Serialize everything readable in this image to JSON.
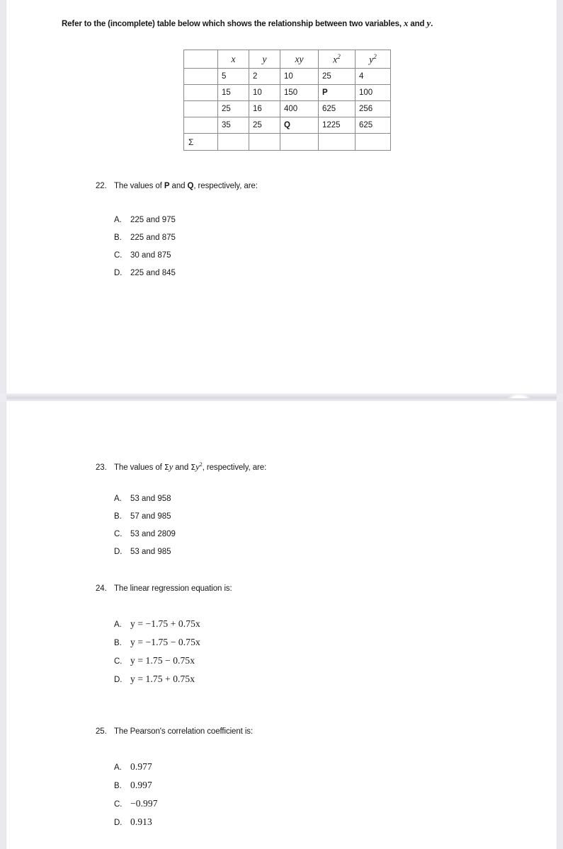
{
  "document": {
    "intro": {
      "before": "Refer to the (incomplete) table below which shows the relationship between two variables, ",
      "var_x": "x",
      "mid": " and ",
      "var_y": "y",
      "after": "."
    }
  },
  "table": {
    "headers": [
      "",
      "x",
      "y",
      "xy",
      "x²",
      "y²"
    ],
    "header_bases": [
      "",
      "x",
      "y",
      "xy",
      "x",
      "y"
    ],
    "header_sups": [
      "",
      "",
      "",
      "",
      "2",
      "2"
    ],
    "rows": [
      {
        "label": "",
        "x": "5",
        "y": "2",
        "xy": "10",
        "x2": "25",
        "y2": "4",
        "bold": ""
      },
      {
        "label": "",
        "x": "15",
        "y": "10",
        "xy": "150",
        "x2": "P",
        "y2": "100",
        "bold": "x2"
      },
      {
        "label": "",
        "x": "25",
        "y": "16",
        "xy": "400",
        "x2": "625",
        "y2": "256",
        "bold": ""
      },
      {
        "label": "",
        "x": "35",
        "y": "25",
        "xy": "Q",
        "x2": "1225",
        "y2": "625",
        "bold": "xy"
      }
    ],
    "sum_row": {
      "label": "Σ",
      "x": "",
      "y": "",
      "xy": "",
      "x2": "",
      "y2": ""
    }
  },
  "questions": [
    {
      "number": "22.",
      "text_parts": [
        {
          "type": "plain",
          "value": "The values of "
        },
        {
          "type": "bold",
          "value": "P"
        },
        {
          "type": "plain",
          "value": " and "
        },
        {
          "type": "bold",
          "value": "Q"
        },
        {
          "type": "plain",
          "value": ", respectively, are:"
        }
      ],
      "text_plain": "The values of P and Q, respectively, are:",
      "style": "plain",
      "options": [
        {
          "letter": "A.",
          "text": "225 and 975"
        },
        {
          "letter": "B.",
          "text": "225 and 875"
        },
        {
          "letter": "C.",
          "text": "30 and 875"
        },
        {
          "letter": "D.",
          "text": "225 and 845"
        }
      ]
    },
    {
      "number": "23.",
      "text_plain": "The values of Σy and Σy², respectively, are:",
      "style": "plain",
      "options": [
        {
          "letter": "A.",
          "text": "53 and 958"
        },
        {
          "letter": "B.",
          "text": "57 and 985"
        },
        {
          "letter": "C.",
          "text": "53 and 2809"
        },
        {
          "letter": "D.",
          "text": "53 and 985"
        }
      ]
    },
    {
      "number": "24.",
      "text_plain": "The linear regression equation is:",
      "style": "math",
      "options": [
        {
          "letter": "A.",
          "text": "y = −1.75 + 0.75x"
        },
        {
          "letter": "B.",
          "text": "y = −1.75 − 0.75x"
        },
        {
          "letter": "C.",
          "text": "y = 1.75 − 0.75x"
        },
        {
          "letter": "D.",
          "text": "y = 1.75 + 0.75x"
        }
      ]
    },
    {
      "number": "25.",
      "text_plain": "The Pearson's correlation coefficient is:",
      "style": "math",
      "options": [
        {
          "letter": "A.",
          "text": "0.977"
        },
        {
          "letter": "B.",
          "text": "0.997"
        },
        {
          "letter": "C.",
          "text": "−0.997"
        },
        {
          "letter": "D.",
          "text": "0.913"
        }
      ]
    }
  ]
}
